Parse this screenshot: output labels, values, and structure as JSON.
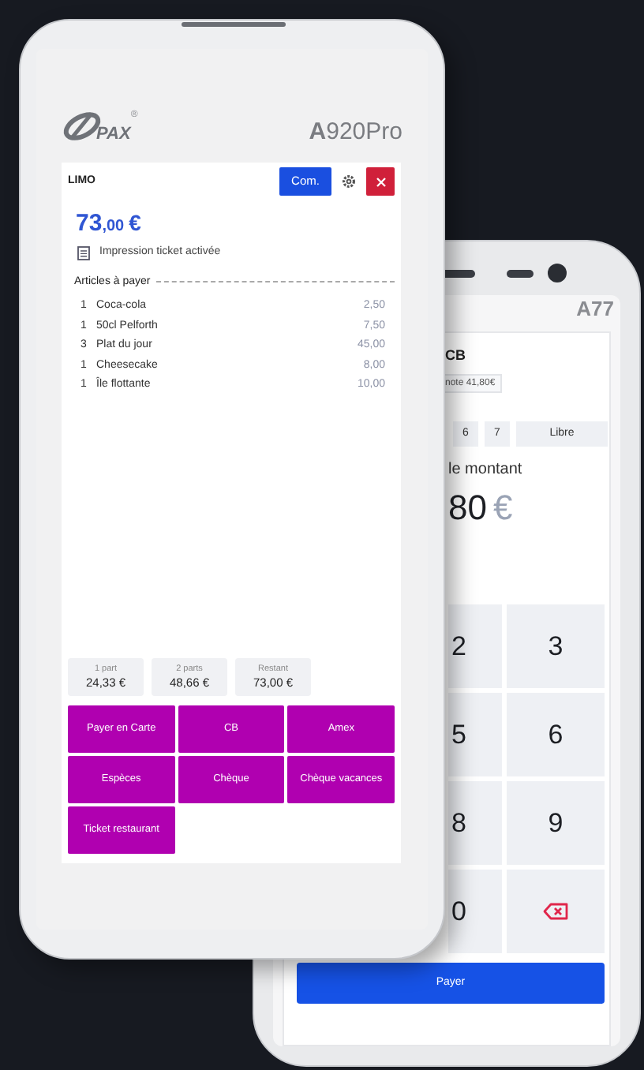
{
  "back_terminal": {
    "model": "A77",
    "screen": {
      "title": "CB",
      "note_chip": "note 41,80€",
      "quick_buttons": [
        "6",
        "7",
        "Libre"
      ],
      "prompt": "le montant",
      "amount": "80",
      "currency": "€",
      "keypad": [
        {
          "kind": "digit",
          "label": "2"
        },
        {
          "kind": "digit",
          "label": "3"
        },
        {
          "kind": "digit",
          "label": "5"
        },
        {
          "kind": "digit",
          "label": "6"
        },
        {
          "kind": "digit",
          "label": "8"
        },
        {
          "kind": "digit",
          "label": "9"
        },
        {
          "kind": "digit",
          "label": "0"
        },
        {
          "kind": "backspace"
        }
      ],
      "pay_button": "Payer"
    }
  },
  "front_terminal": {
    "brand": "PAX",
    "brand_mark": "®",
    "model": "**A**920Pro",
    "screen": {
      "title": "LIMO",
      "comment_button": "Com.",
      "amount": {
        "integer": "73",
        "decimals": ",00",
        "currency": "€"
      },
      "print_notice": "Impression ticket activée",
      "items_heading": "Articles à payer",
      "items": [
        {
          "qty": "1",
          "name": "Coca-cola",
          "price": "2,50"
        },
        {
          "qty": "1",
          "name": "50cl Pelforth",
          "price": "7,50"
        },
        {
          "qty": "3",
          "name": "Plat du jour",
          "price": "45,00"
        },
        {
          "qty": "1",
          "name": "Cheesecake",
          "price": "8,00"
        },
        {
          "qty": "1",
          "name": "Île flottante",
          "price": "10,00"
        }
      ],
      "splits": [
        {
          "label": "1 part",
          "value": "24,33 €"
        },
        {
          "label": "2 parts",
          "value": "48,66 €"
        },
        {
          "label": "Restant",
          "value": "73,00 €"
        }
      ],
      "payment_methods": [
        "Payer en Carte",
        "CB",
        "Amex",
        "Espèces",
        "Chèque",
        "Chèque vacances",
        "Ticket restaurant"
      ]
    }
  }
}
